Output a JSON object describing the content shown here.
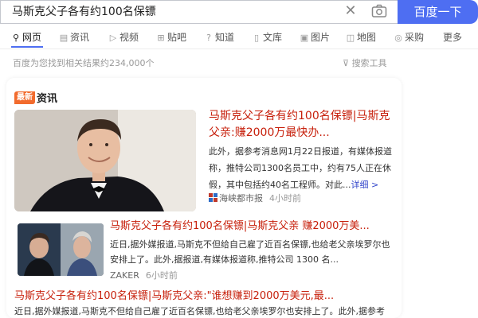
{
  "search": {
    "query": "马斯克父子各有约100名保镖",
    "clear_icon": "close-icon",
    "camera_icon": "camera-icon",
    "button_label": "百度一下",
    "accent": "#4e6ef2"
  },
  "tabs": [
    {
      "label": "网页",
      "icon": "search-icon",
      "active": true
    },
    {
      "label": "资讯",
      "icon": "news-icon"
    },
    {
      "label": "视频",
      "icon": "video-icon"
    },
    {
      "label": "贴吧",
      "icon": "tieba-icon"
    },
    {
      "label": "知道",
      "icon": "question-icon"
    },
    {
      "label": "文库",
      "icon": "document-icon"
    },
    {
      "label": "图片",
      "icon": "image-icon"
    },
    {
      "label": "地图",
      "icon": "map-icon"
    },
    {
      "label": "采购",
      "icon": "purchase-icon"
    },
    {
      "label": "更多"
    }
  ],
  "result_count": "百度为您找到相关结果约234,000个",
  "search_tools": "搜索工具",
  "card": {
    "badge": "最新",
    "label": "资讯",
    "items": [
      {
        "title": "马斯克父子各有约100名保镖|马斯克父亲:赚2000万最快办...",
        "body": "此外，据参考消息网1月22日报道，有媒体报道称，推特公司1300名员工中，约有75人正在休假，其中包括约40名工程师。对此...",
        "detail_link": "详细 >",
        "source": "海峡都市报",
        "time": "4小时前"
      },
      {
        "title": "马斯克父子各有约100名保镖|马斯克父亲 赚2000万美...",
        "body": "近日,据外媒报道,马斯克不但给自己雇了近百名保镖,也给老父亲埃罗尔也安排上了。此外,据报道,有媒体报道称,推特公司 1300 名...",
        "source": "ZAKER",
        "time": "6小时前"
      },
      {
        "title": "马斯克父子各有约100名保镖|马斯克父亲:\"谁想赚到2000万美元,最...",
        "body": "近日,据外媒报道,马斯克不但给自己雇了近百名保镖,也给老父亲埃罗尔也安排上了。此外,据参考"
      }
    ]
  },
  "colors": {
    "title_red": "#c7200c",
    "badge_orange": "#f26b2d",
    "link_blue": "#3245ca"
  }
}
